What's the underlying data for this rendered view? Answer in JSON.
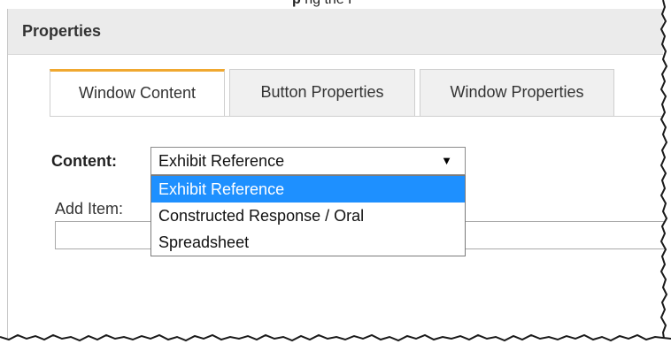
{
  "top_strip": {
    "bold_fragment": "p",
    "rest_fragment": "ng the P"
  },
  "panel": {
    "title": "Properties"
  },
  "tabs": [
    {
      "label": "Window Content",
      "active": true
    },
    {
      "label": "Button Properties",
      "active": false
    },
    {
      "label": "Window Properties",
      "active": false
    }
  ],
  "content_field": {
    "label": "Content:",
    "selected_value": "Exhibit Reference",
    "arrow_icon": "triangle-down-icon"
  },
  "add_item": {
    "label": "Add Item:",
    "value": ""
  },
  "dropdown": {
    "options": [
      {
        "label": "Exhibit Reference",
        "highlighted": true
      },
      {
        "label": "Constructed Response / Oral",
        "highlighted": false
      },
      {
        "label": "Spreadsheet",
        "highlighted": false
      }
    ]
  },
  "colors": {
    "header_bg": "#ebebeb",
    "active_tab_accent": "#f0a830",
    "highlight": "#1e90ff"
  }
}
